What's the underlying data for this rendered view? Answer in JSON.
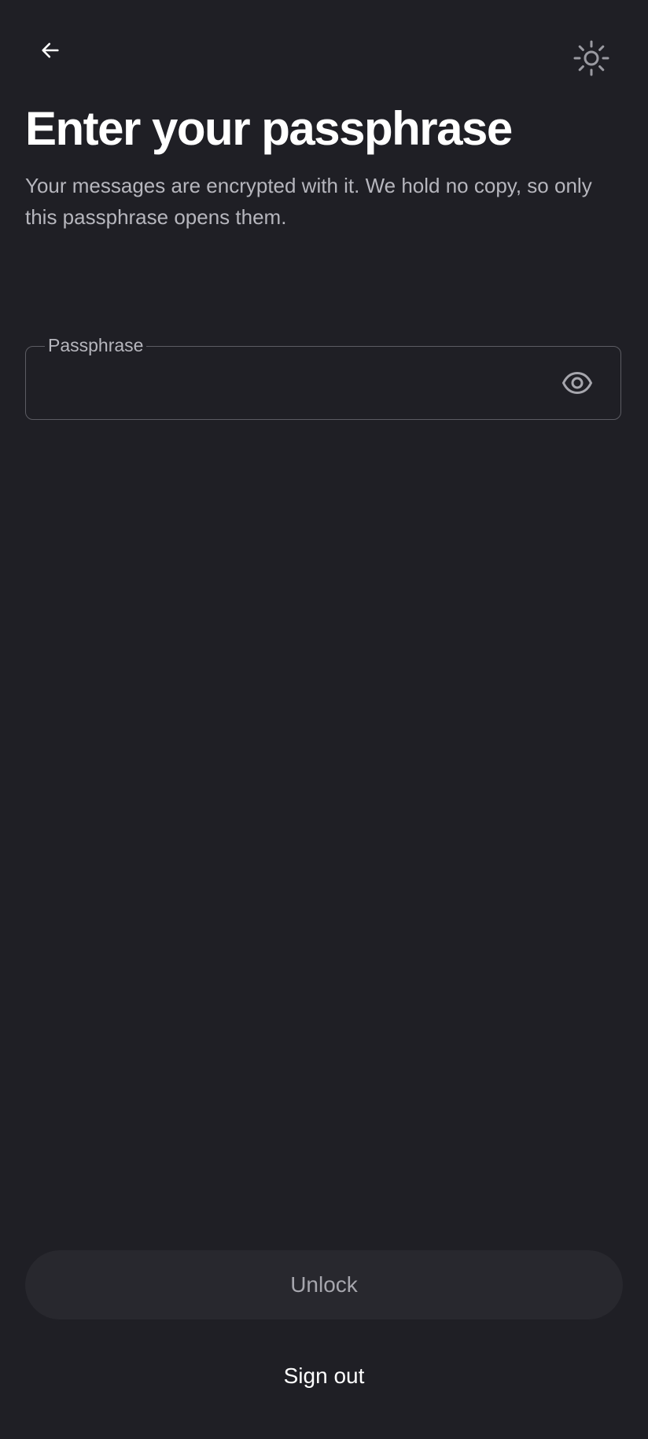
{
  "header": {
    "back_icon": "arrow-left-icon",
    "theme_icon": "sun-icon"
  },
  "title": "Enter your passphrase",
  "subtitle": "Your messages are encrypted with it. We hold no copy, so only this passphrase opens them.",
  "passphrase_field": {
    "label": "Passphrase",
    "value": "",
    "placeholder": "",
    "toggle_icon": "eye-icon"
  },
  "actions": {
    "unlock_label": "Unlock",
    "signout_label": "Sign out"
  },
  "colors": {
    "background": "#1f1f25",
    "text_primary": "#ffffff",
    "text_secondary": "#b6b6bd",
    "field_border": "#5c5c63",
    "button_disabled_bg": "#28282e",
    "button_disabled_text": "#a6a6ad"
  }
}
